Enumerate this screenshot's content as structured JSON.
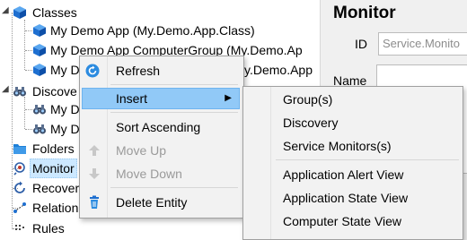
{
  "tree": {
    "classes_label": "Classes",
    "class_items": [
      "My Demo App (My.Demo.App.Class)",
      "My Demo App ComputerGroup (My.Demo.Ap",
      "My D"
    ],
    "class_item_3_tail": "y.Demo.App",
    "discoveries_label": "Discove",
    "discovery_items": [
      "My D",
      "My D"
    ],
    "folders_label": "Folders",
    "monitors_label": "Monitor",
    "recoveries_label": "Recover",
    "relationships_label": "Relation",
    "rules_label": "Rules"
  },
  "right_panel": {
    "title": "Monitor",
    "id_label": "ID",
    "id_value": "Service.Monito",
    "name_label": "Name"
  },
  "context_menu": {
    "items": {
      "refresh": "Refresh",
      "insert": "Insert",
      "sort_ascending": "Sort Ascending",
      "move_up": "Move Up",
      "move_down": "Move Down",
      "delete_entity": "Delete Entity"
    }
  },
  "submenu": {
    "items": {
      "groups": "Group(s)",
      "discovery": "Discovery",
      "service_monitors": "Service Monitors(s)",
      "application_alert_view": "Application Alert View",
      "application_state_view": "Application State View",
      "computer_state_view": "Computer State View"
    }
  },
  "colors": {
    "menu_highlight": "#91c9f7",
    "tree_selection": "#cce8ff",
    "class_icon_blue": "#1e6fd0"
  },
  "icons": [
    "cube-icon",
    "binoculars-icon",
    "folder-icon",
    "monitor-icon",
    "recovery-icon",
    "relationship-icon",
    "rules-icon",
    "refresh-icon",
    "arrow-up-icon",
    "arrow-down-icon",
    "trash-icon",
    "chevron-right-icon"
  ]
}
